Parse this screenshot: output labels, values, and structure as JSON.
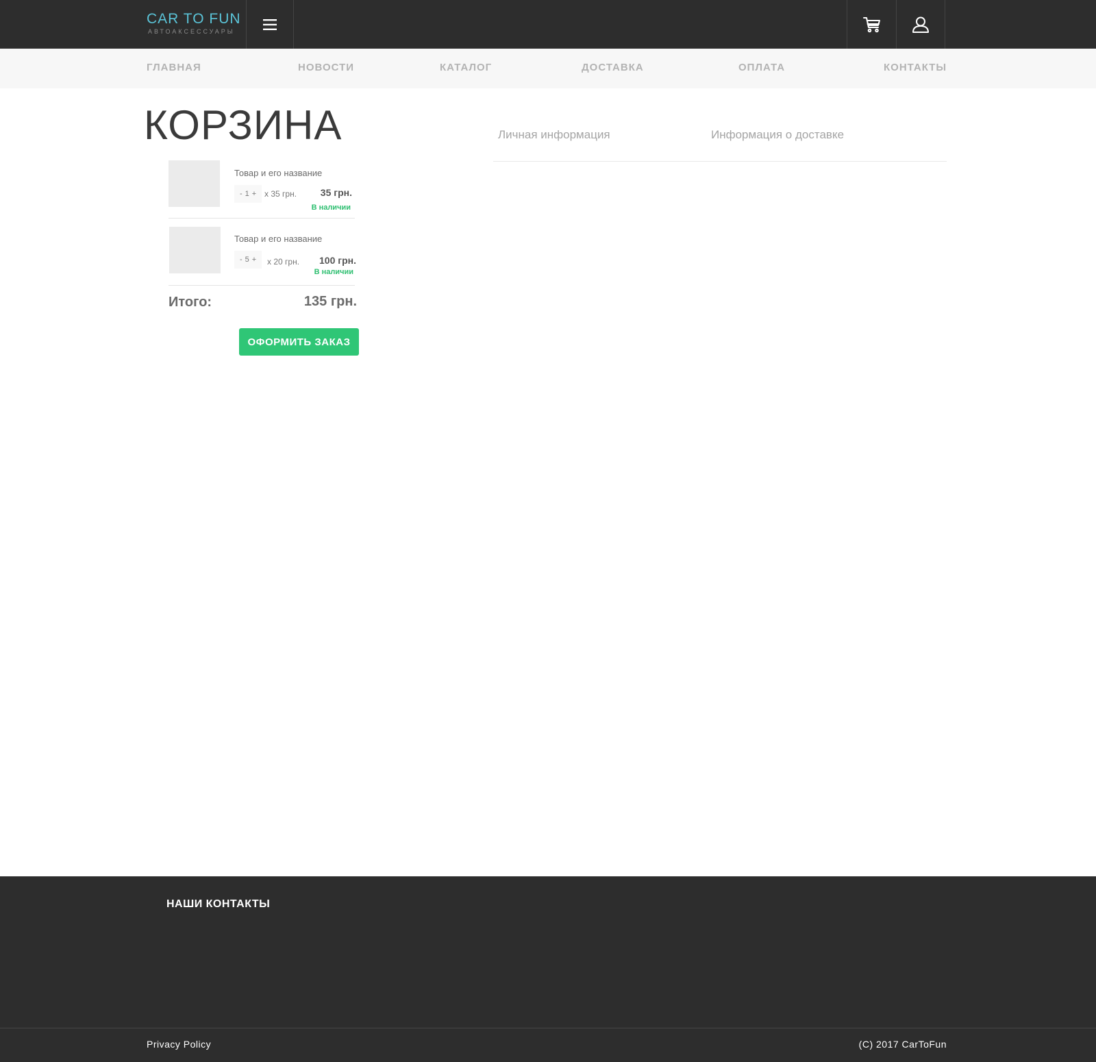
{
  "header": {
    "brand_name": "CAR TO FUN",
    "brand_subtitle": "АВТОАКСЕССУАРЫ",
    "menu_icon": "hamburger-menu-icon",
    "cart_icon": "shopping-cart-icon",
    "user_icon": "user-icon",
    "brand_color": "#5bc4d8",
    "background_color": "#2d2d2d"
  },
  "nav": {
    "items": [
      {
        "label": "ГЛАВНАЯ"
      },
      {
        "label": "НОВОСТИ"
      },
      {
        "label": "КАТАЛОГ"
      },
      {
        "label": "ДОСТАВКА"
      },
      {
        "label": "ОПЛАТА"
      },
      {
        "label": "КОНТАКТЫ"
      }
    ]
  },
  "cart": {
    "title": "КОРЗИНА",
    "items": [
      {
        "name": "Товар и его название",
        "qty_minus": "-",
        "qty": "1",
        "qty_plus": "+",
        "unit_price": "x 35 грн.",
        "total": "35 грн.",
        "stock": "В наличии"
      },
      {
        "name": "Товар и его название",
        "qty_minus": "-",
        "qty": "5",
        "qty_plus": "+",
        "unit_price": "x 20 грн.",
        "total": "100 грн.",
        "stock": "В наличии"
      }
    ],
    "sum_label": "Итого:",
    "sum_value": "135 грн.",
    "order_button": "ОФОРМИТЬ ЗАКАЗ",
    "accent_color": "#2fc676"
  },
  "tabs": [
    {
      "label": "Личная информация"
    },
    {
      "label": "Информация о доставке"
    }
  ],
  "footer": {
    "title": "НАШИ КОНТАКТЫ",
    "privacy": "Privacy Policy",
    "copyright": "(C) 2017 CarToFun"
  }
}
